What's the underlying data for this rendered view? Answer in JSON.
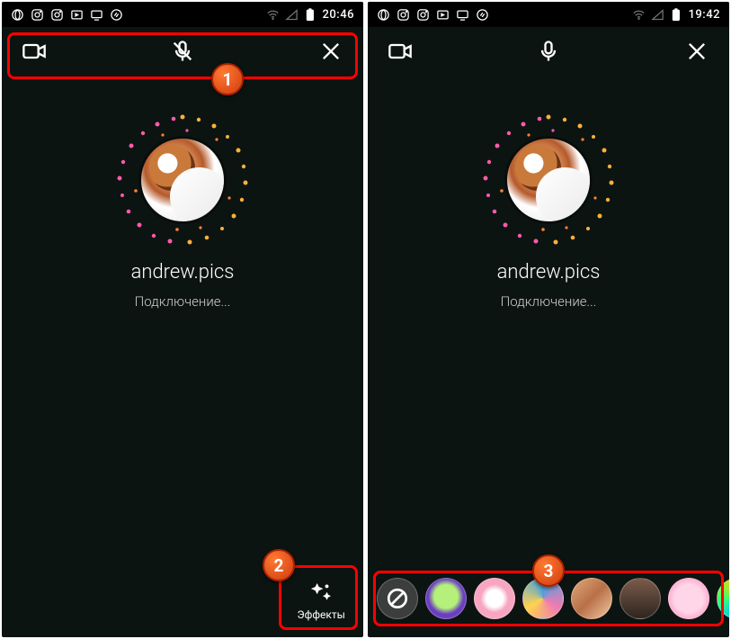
{
  "left": {
    "status": {
      "time": "20:46"
    },
    "call": {
      "username": "andrew.pics",
      "status": "Подключение..."
    },
    "effects_button": {
      "label": "Эффекты"
    },
    "badges": {
      "b1": "1",
      "b2": "2"
    }
  },
  "right": {
    "status": {
      "time": "19:42"
    },
    "call": {
      "username": "andrew.pics",
      "status": "Подключение..."
    },
    "badges": {
      "b3": "3"
    },
    "effects": {
      "items": [
        "none",
        "alien",
        "panda",
        "rainbow",
        "desert",
        "gray",
        "pink",
        "share"
      ]
    }
  },
  "colors": {
    "highlight": "#ff0000",
    "badge_grad_a": "#ff7a33",
    "badge_grad_b": "#d13a0e"
  }
}
